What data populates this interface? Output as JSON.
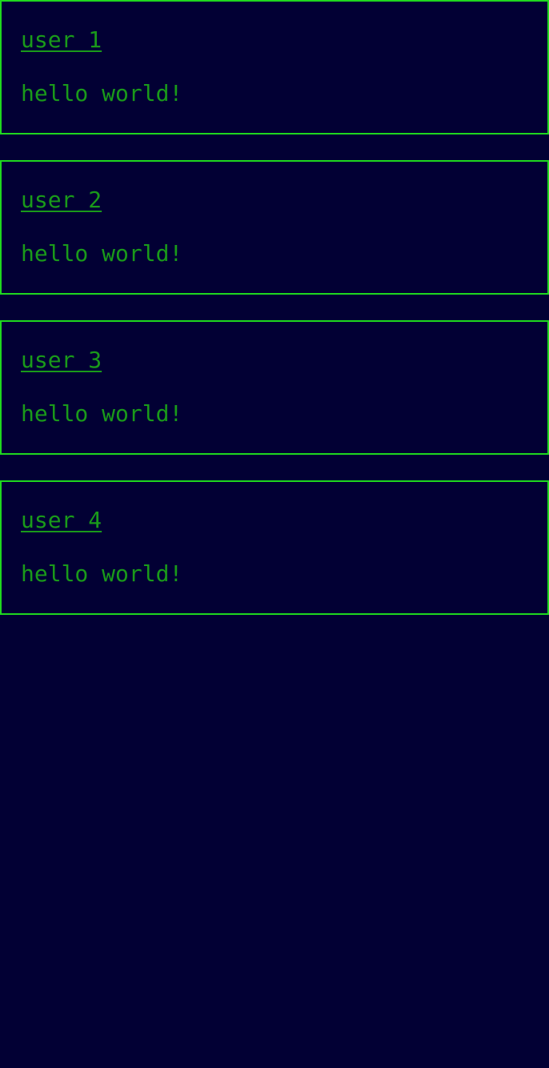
{
  "theme": {
    "background": "#020034",
    "border": "#1fd81f",
    "text": "#1a9a1a"
  },
  "posts": [
    {
      "author": "user 1",
      "message": "hello world!"
    },
    {
      "author": "user 2",
      "message": "hello world!"
    },
    {
      "author": "user 3",
      "message": "hello world!"
    },
    {
      "author": "user 4",
      "message": "hello world!"
    }
  ]
}
